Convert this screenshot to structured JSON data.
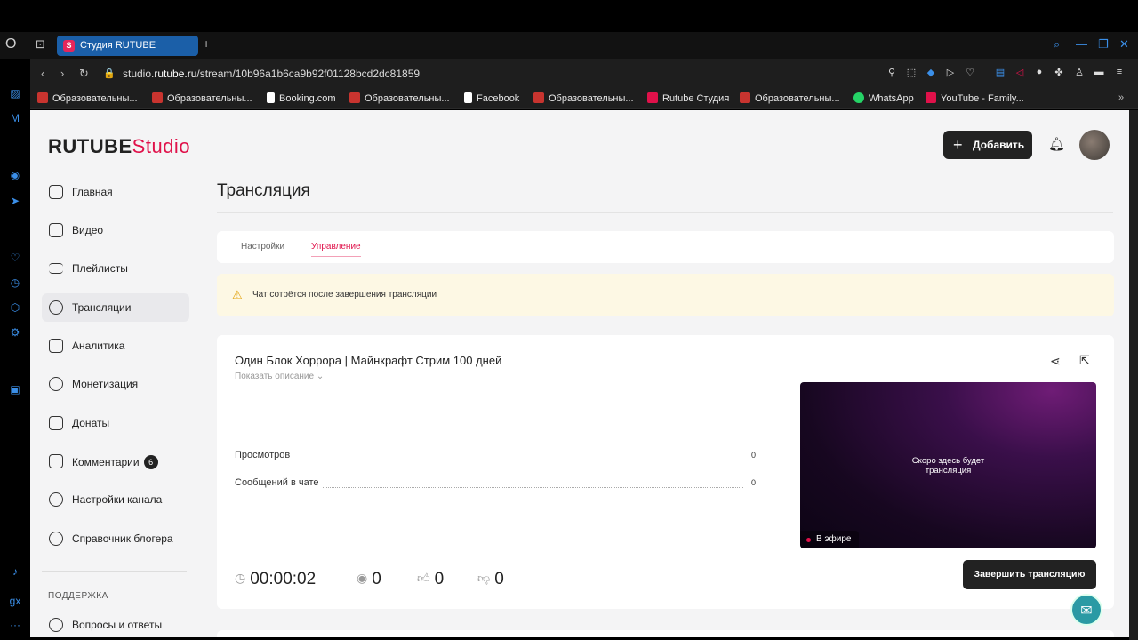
{
  "browser": {
    "tab_title": "Студия RUTUBE",
    "tab_favicon": "S",
    "url_prefix": "studio.",
    "url_domain": "rutube.ru",
    "url_path": "/stream/10b96a1b6ca9b92f01128bcd2dc81859",
    "bookmarks": [
      {
        "label": "Образовательны...",
        "color": "#c8342f"
      },
      {
        "label": "Образовательны...",
        "color": "#c8342f"
      },
      {
        "label": "Booking.com",
        "color": "#ffffff"
      },
      {
        "label": "Образовательны...",
        "color": "#c8342f"
      },
      {
        "label": "Facebook",
        "color": "#ffffff"
      },
      {
        "label": "Образовательны...",
        "color": "#c8342f"
      },
      {
        "label": "Rutube Студия",
        "color": "#e0114a"
      },
      {
        "label": "Образовательны...",
        "color": "#c8342f"
      },
      {
        "label": "WhatsApp",
        "color": "#25d366"
      },
      {
        "label": "YouTube - Family...",
        "color": "#e0114a"
      }
    ]
  },
  "logo": {
    "main": "RUTUBE",
    "sub": "Studio"
  },
  "sidebar": {
    "items": [
      {
        "label": "Главная",
        "icon": "home-icon"
      },
      {
        "label": "Видео",
        "icon": "video-icon"
      },
      {
        "label": "Плейлисты",
        "icon": "playlist-icon"
      },
      {
        "label": "Трансляции",
        "icon": "broadcast-icon",
        "active": true
      },
      {
        "label": "Аналитика",
        "icon": "analytics-icon"
      },
      {
        "label": "Монетизация",
        "icon": "ruble-icon"
      },
      {
        "label": "Донаты",
        "icon": "wallet-icon"
      },
      {
        "label": "Комментарии",
        "icon": "comment-icon",
        "badge": "6"
      },
      {
        "label": "Настройки канала",
        "icon": "gear-icon"
      },
      {
        "label": "Справочник блогера",
        "icon": "info-icon"
      }
    ],
    "support_heading": "ПОДДЕРЖКА",
    "support_items": [
      {
        "label": "Вопросы и ответы",
        "icon": "question-icon"
      }
    ]
  },
  "header": {
    "add_label": "Добавить"
  },
  "page": {
    "title": "Трансляция",
    "tabs": [
      {
        "label": "Настройки"
      },
      {
        "label": "Управление",
        "active": true
      }
    ],
    "warning": "Чат сотрётся после завершения трансляции",
    "stream": {
      "title": "Один Блок Хоррора | Майнкрафт Стрим 100 дней",
      "show_description": "Показать описание",
      "stats": [
        {
          "label": "Просмотров",
          "value": "0"
        },
        {
          "label": "Сообщений в чате",
          "value": "0"
        }
      ],
      "player_message_line1": "Скоро здесь будет",
      "player_message_line2": "трансляция",
      "live_label": "В эфире",
      "duration": "00:00:02",
      "viewers": "0",
      "likes": "0",
      "dislikes": "0",
      "end_label": "Завершить трансляцию"
    }
  },
  "colors": {
    "accent": "#e0114a",
    "dark_button": "#222222",
    "warning_bg": "#fdf8e4"
  }
}
